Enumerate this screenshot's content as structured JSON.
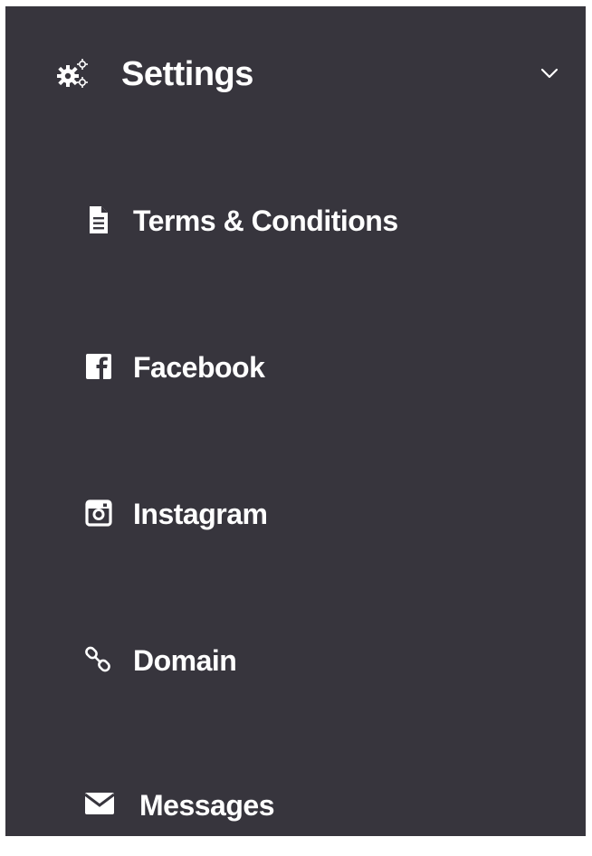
{
  "colors": {
    "sidebar_bg": "#37353d",
    "text": "#ffffff"
  },
  "menu": {
    "title": "Settings",
    "title_icon": "gears-icon",
    "expanded": true,
    "chevron_icon": "chevron-down-icon",
    "items": [
      {
        "label": "Terms & Conditions",
        "icon": "file-text-icon"
      },
      {
        "label": "Facebook",
        "icon": "facebook-icon"
      },
      {
        "label": "Instagram",
        "icon": "instagram-icon"
      },
      {
        "label": "Domain",
        "icon": "link-icon"
      },
      {
        "label": "Messages",
        "icon": "envelope-icon"
      }
    ]
  }
}
